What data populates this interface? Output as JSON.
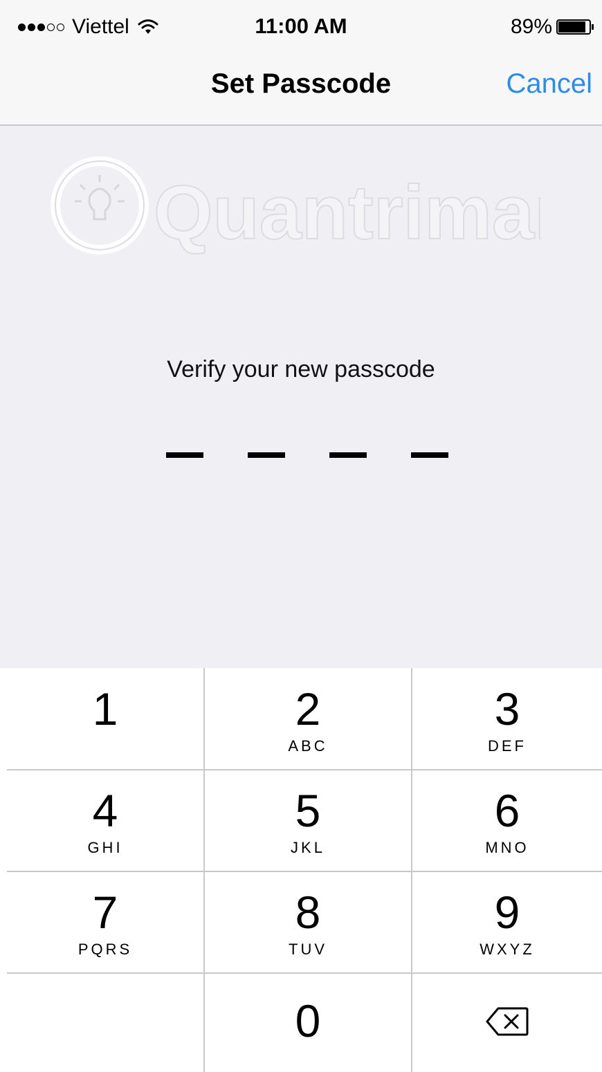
{
  "status_bar": {
    "signal_bars_filled": 3,
    "signal_bars_total": 5,
    "carrier": "Viettel",
    "time": "11:00 AM",
    "battery_percent": "89%",
    "battery_level": 0.89,
    "icons": [
      "signal-dots-icon",
      "wifi-icon",
      "battery-icon"
    ]
  },
  "nav": {
    "title": "Set Passcode",
    "cancel_label": "Cancel",
    "accent_color": "#2a8cf0"
  },
  "watermark": {
    "text": "Quantrimang",
    "icon": "lightbulb-icon"
  },
  "passcode": {
    "prompt": "Verify your new passcode",
    "length": 4,
    "entered": 0
  },
  "keypad": {
    "keys": [
      {
        "digit": "1",
        "letters": ""
      },
      {
        "digit": "2",
        "letters": "ABC"
      },
      {
        "digit": "3",
        "letters": "DEF"
      },
      {
        "digit": "4",
        "letters": "GHI"
      },
      {
        "digit": "5",
        "letters": "JKL"
      },
      {
        "digit": "6",
        "letters": "MNO"
      },
      {
        "digit": "7",
        "letters": "PQRS"
      },
      {
        "digit": "8",
        "letters": "TUV"
      },
      {
        "digit": "9",
        "letters": "WXYZ"
      },
      {
        "digit": "",
        "letters": ""
      },
      {
        "digit": "0",
        "letters": ""
      },
      {
        "digit": "",
        "letters": "",
        "icon": "delete-backspace-icon"
      }
    ]
  }
}
